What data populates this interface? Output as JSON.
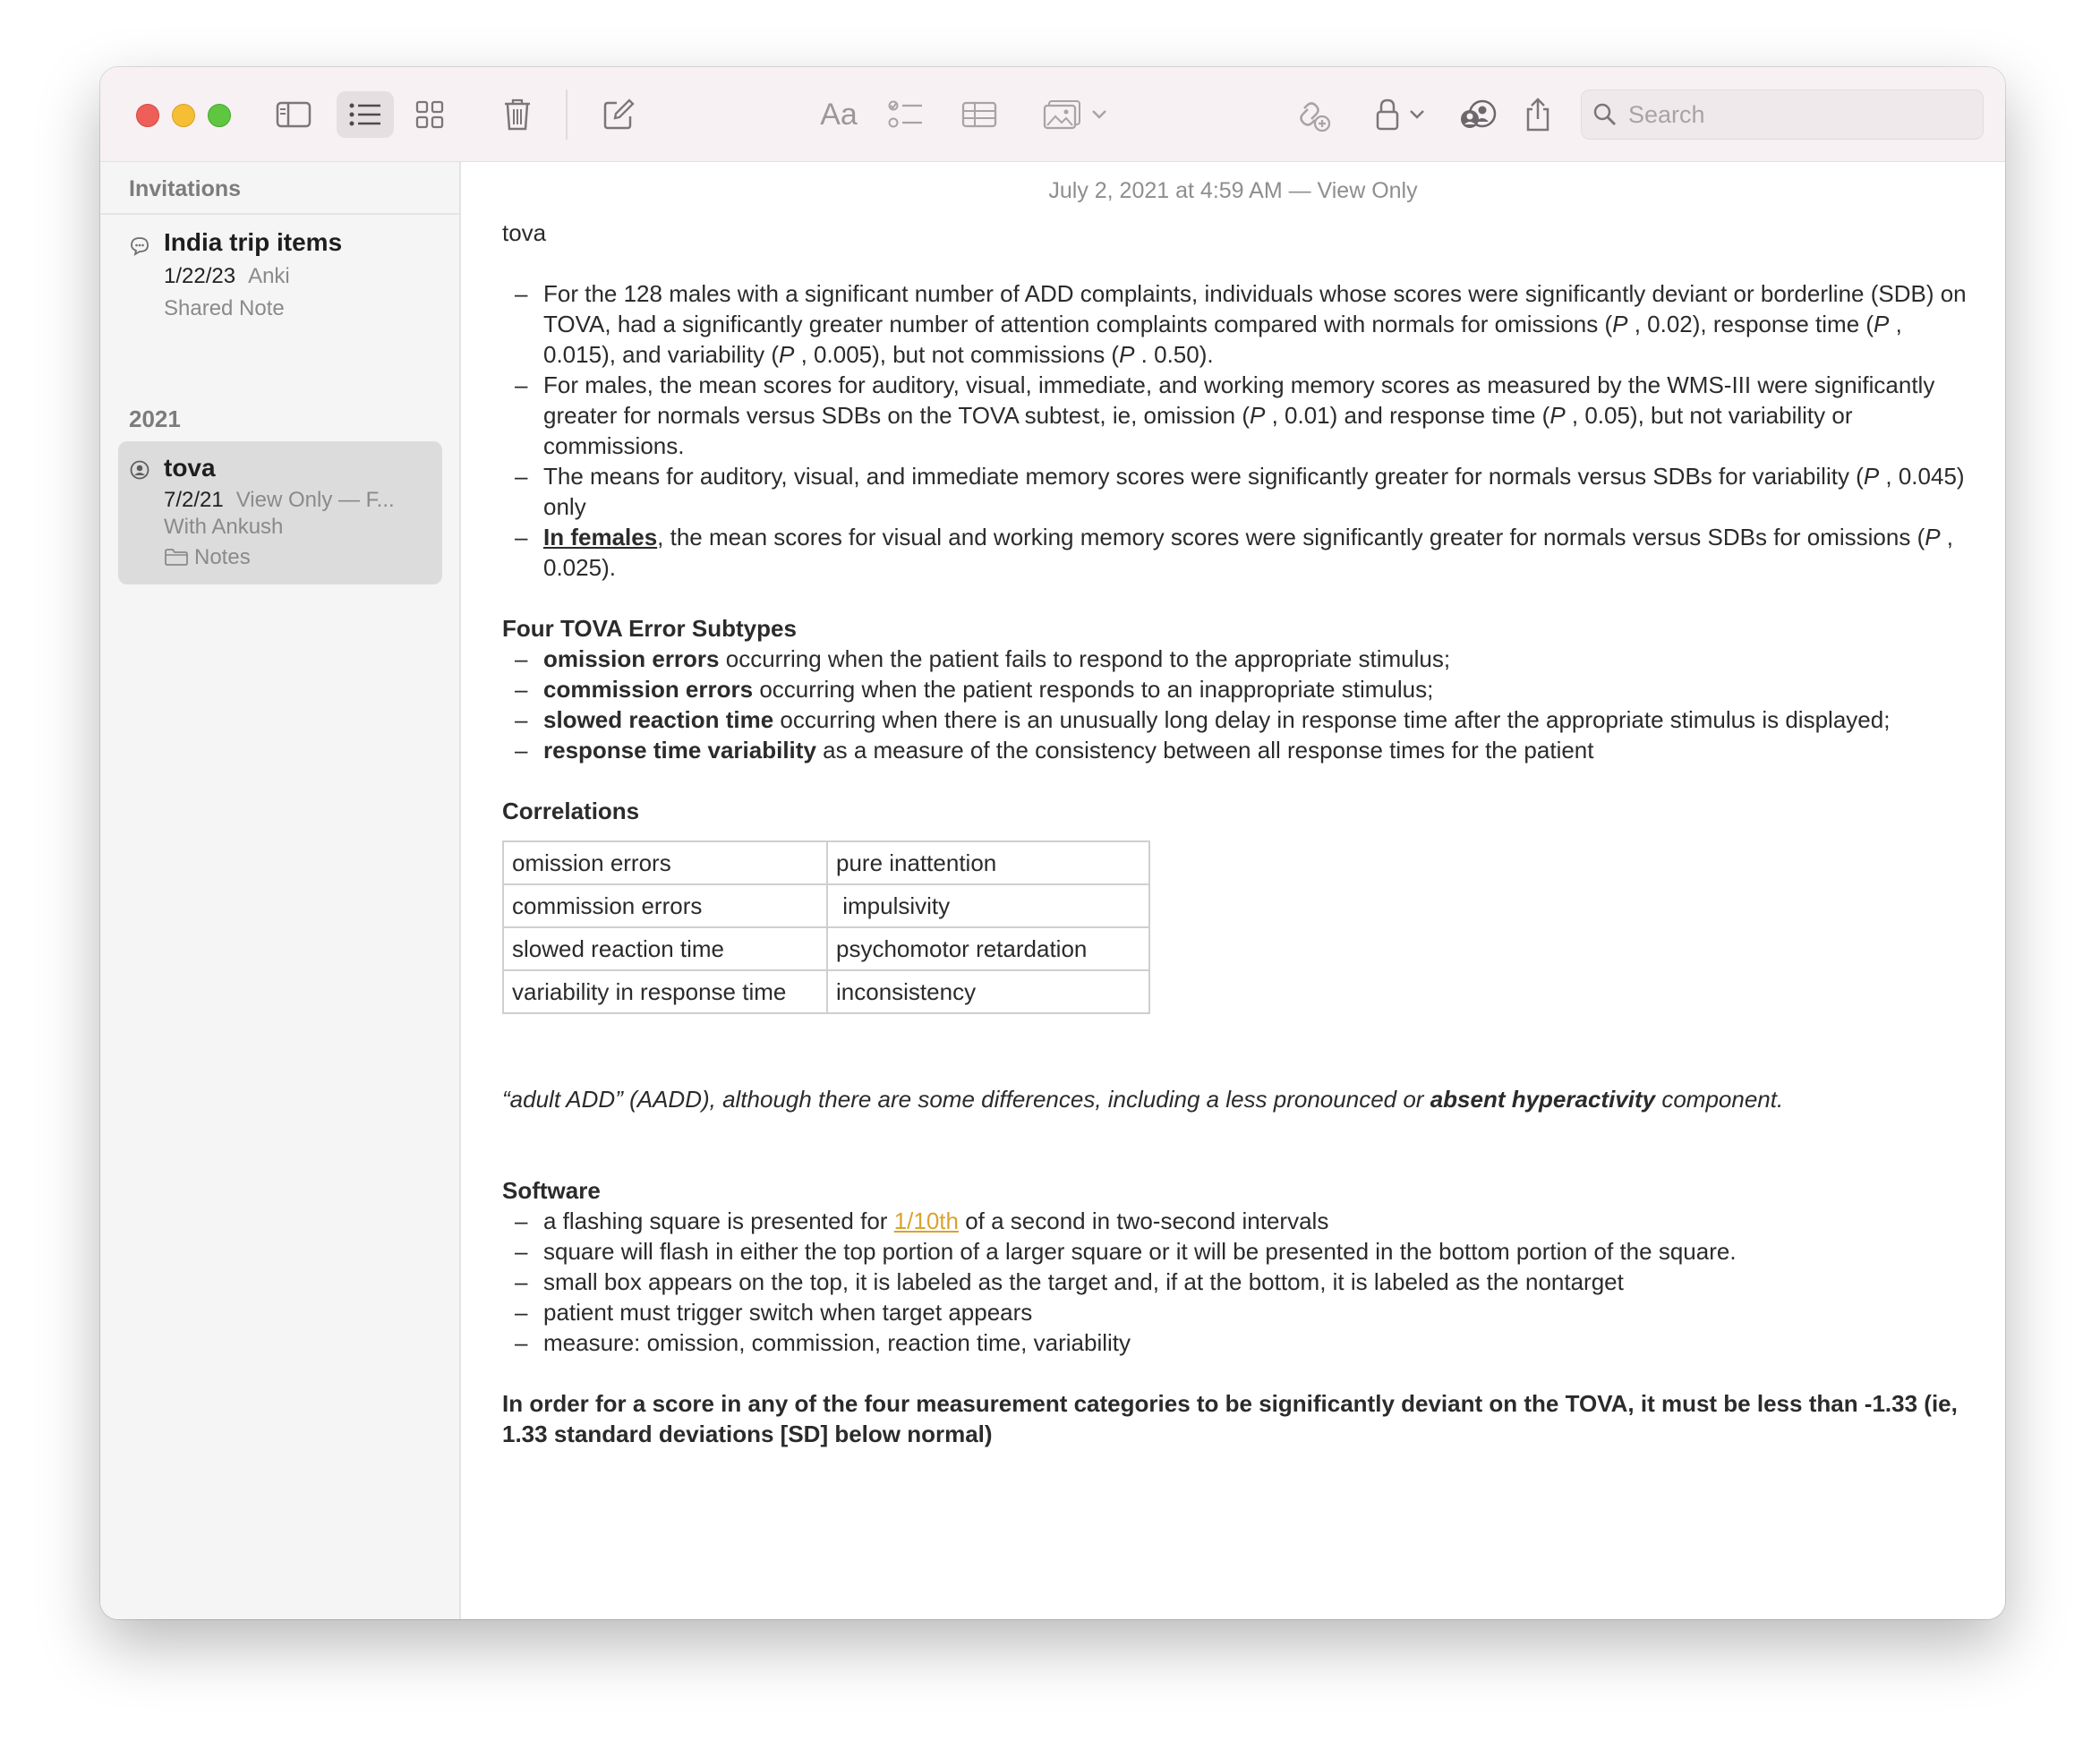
{
  "toolbar": {
    "search_placeholder": "Search",
    "format_label": "Aa"
  },
  "sidebar": {
    "header": "Invitations",
    "section": "2021",
    "notes": [
      {
        "title": "India trip items",
        "date": "1/22/23",
        "preview": "Anki",
        "line3": "Shared Note",
        "icon": "shared-note-icon"
      },
      {
        "title": "tova",
        "date": "7/2/21",
        "preview": "View Only — F...",
        "line3": "With Ankush",
        "folder": "Notes",
        "icon": "person-circle-icon",
        "selected": true
      }
    ]
  },
  "note": {
    "meta": "July 2, 2021 at 4:59 AM — View Only",
    "title": "tova",
    "bullets1": [
      {
        "b1": "For the 128 males with a significant number of ADD complaints, individuals whose scores were significantly deviant or borderline (SDB) on TOVA, had a significantly greater number of attention complaints compared with normals for omissions (",
        "i1": "P",
        "b2": " , 0.02), response time (",
        "i2": "P",
        "b3": " , 0.015), and variability (",
        "i3": "P",
        "b4": " , 0.005), but not commissions (",
        "i4": "P",
        "b5": " . 0.50)."
      },
      {
        "b1": "For males, the mean scores for auditory, visual, immediate, and working memory scores as measured by the WMS-III were significantly greater for normals versus SDBs on the TOVA subtest, ie, omission (",
        "i1": "P",
        "b2": " , 0.01) and response time (",
        "i2": "P",
        "b3": " , 0.05), but not variability or commissions."
      },
      {
        "b1": "The means for auditory, visual, and immediate memory scores were significantly greater for normals versus SDBs for variability (",
        "i1": "P",
        "b2": " , 0.045) only"
      },
      {
        "u": "In females",
        "b1": ", the mean scores for visual and working memory scores were significantly greater for normals versus SDBs for omissions (",
        "i1": "P",
        "b2": " , 0.025)."
      }
    ],
    "subtypes_heading": "Four TOVA Error Subtypes",
    "subtypes": [
      {
        "bold": "omission errors",
        "text": " occurring when the patient fails to respond to the appropriate stimulus;"
      },
      {
        "bold": "commission errors",
        "text": " occurring when the patient responds to an inappropriate stimulus;"
      },
      {
        "bold": "slowed reaction time",
        "text": " occurring when there is an unusually long delay in response time after the appropriate stimulus is displayed;"
      },
      {
        "bold": "response time variability",
        "text": " as a measure of the consistency between all response times for the patient"
      }
    ],
    "correlations_heading": "Correlations",
    "correlations": [
      [
        "omission errors",
        "pure inattention"
      ],
      [
        "commission errors",
        " impulsivity"
      ],
      [
        "slowed reaction time",
        "psychomotor retardation"
      ],
      [
        "variability in response time",
        "inconsistency"
      ]
    ],
    "quote": {
      "a": "“adult ADD” (AADD), although there are some differences, including a less pronounced or ",
      "b": "absent hyperactivity",
      "c": " component."
    },
    "software_heading": "Software",
    "software": [
      {
        "a": "a flashing square is presented for ",
        "link": "1/10th",
        "b": " of a second in two-second intervals"
      },
      {
        "a": "square will flash in either the top portion of a larger square or it will be presented in the bottom portion of the square."
      },
      {
        "a": "small box appears on the top, it is labeled as the target and, if at the bottom, it is labeled as the nontarget"
      },
      {
        "a": "patient must trigger switch when target appears"
      },
      {
        "a": "measure: omission, commission, reaction time, variability"
      }
    ],
    "final": "In order for a score in any of the four measurement categories to be significantly deviant on the TOVA, it must be less than -1.33 (ie, 1.33 standard deviations [SD] below normal)"
  }
}
